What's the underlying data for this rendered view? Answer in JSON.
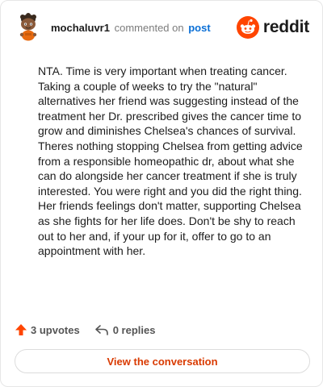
{
  "comment": {
    "username": "mochaluvr1",
    "action_text": "commented on",
    "post_link_text": "post",
    "body": "NTA. Time is very important when treating cancer. Taking a couple of weeks to try the \"natural\" alternatives her friend was suggesting instead of the treatment her Dr. prescribed gives the cancer time to grow and diminishes Chelsea's chances of survival. Theres nothing stopping Chelsea from getting advice from a responsible homeopathic dr, about what she can do alongside her cancer treatment if she is truly interested. You were right and you did the right thing. Her friends feelings don't matter, supporting Chelsea as she fights for her life does. Don't be shy to reach out to her and, if your up for it, offer to go to an appointment with her."
  },
  "brand": {
    "wordmark": "reddit",
    "logo_icon": "reddit-snoo-icon",
    "accent_color": "#ff4500"
  },
  "stats": {
    "upvotes": "3 upvotes",
    "replies": "0 replies",
    "upvote_icon": "upvote-arrow-icon",
    "reply_icon": "reply-arrow-icon"
  },
  "cta": {
    "label": "View the conversation",
    "color": "#d93a00"
  }
}
